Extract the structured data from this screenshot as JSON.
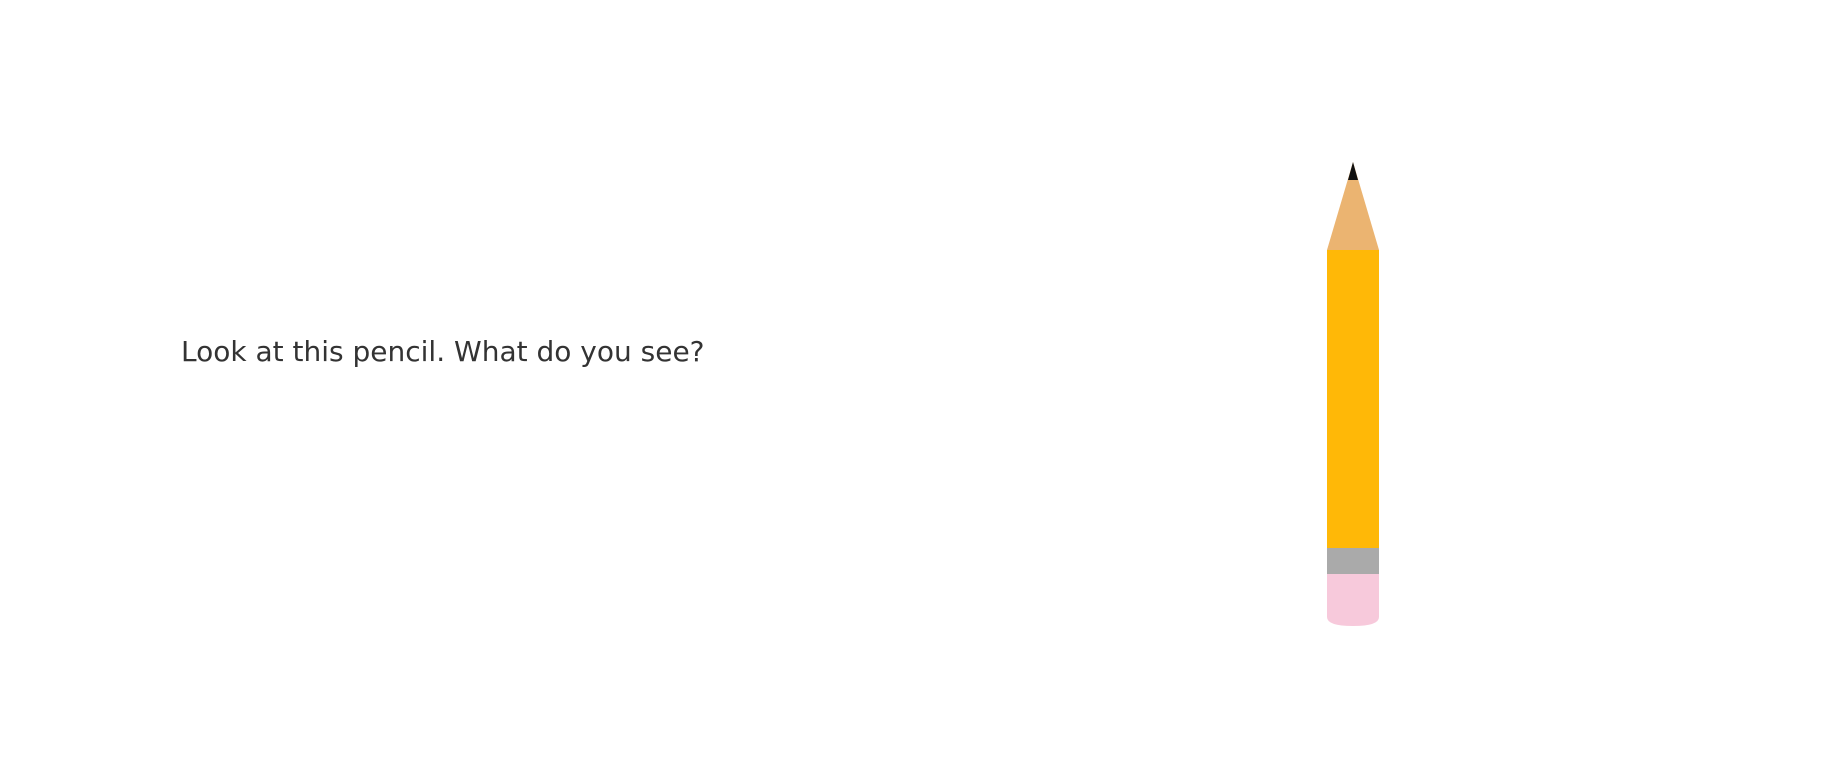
{
  "prompt": {
    "text": "Look at this pencil. What do you see?"
  },
  "pencil": {
    "icon": "pencil-icon",
    "colors": {
      "lead": "#111111",
      "wood_tip": "#EBB471",
      "body": "#FFB807",
      "ferrule": "#AAAAAA",
      "eraser": "#F7C9DB"
    }
  }
}
